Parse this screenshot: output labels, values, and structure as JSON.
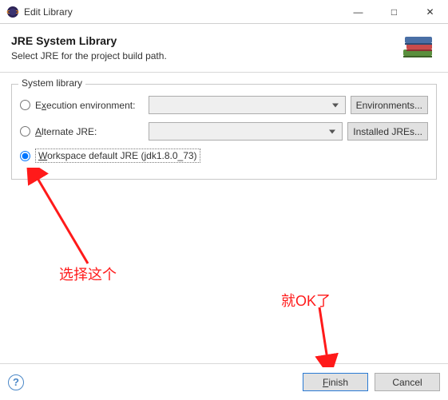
{
  "window": {
    "title": "Edit Library",
    "minimize": "—",
    "maximize": "□",
    "close": "✕"
  },
  "header": {
    "title": "JRE System Library",
    "subtitle": "Select JRE for the project build path."
  },
  "group": {
    "legend": "System library",
    "options": {
      "exec_env": "Execution environment:",
      "alt_jre": "Alternate JRE:",
      "workspace_default": "Workspace default JRE (jdk1.8.0_73)"
    },
    "buttons": {
      "environments": "Environments...",
      "installed_jres": "Installed JREs..."
    }
  },
  "footer": {
    "finish": "Finish",
    "cancel": "Cancel",
    "help": "?"
  },
  "annotations": {
    "select_this": "选择这个",
    "then_ok": "就OK了"
  }
}
